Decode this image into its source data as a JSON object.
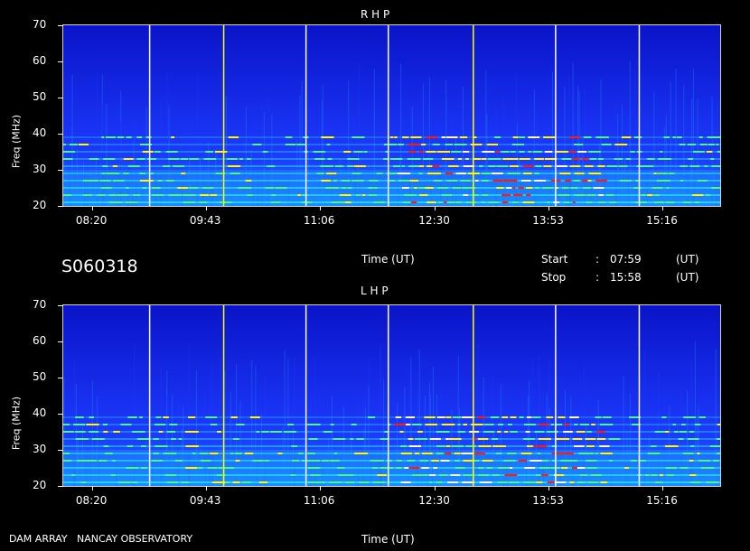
{
  "header": {
    "session_id": "S060318",
    "time_axis_label": "Time (UT)",
    "start_label": "Start",
    "stop_label": "Stop",
    "separator": ":",
    "start_time": "07:59",
    "stop_time": "15:58",
    "unit": "(UT)"
  },
  "footer": {
    "credit": "DAM ARRAY   NANCAY OBSERVATORY",
    "time_axis_label": "Time (UT)"
  },
  "chart_data": [
    {
      "type": "heatmap",
      "title": "R H P",
      "xlabel": "Time (UT)",
      "ylabel": "Freq (MHz)",
      "xlim": [
        "07:59",
        "15:58"
      ],
      "ylim": [
        20,
        70
      ],
      "x_ticks": [
        "08:20",
        "09:43",
        "11:06",
        "12:30",
        "13:53",
        "15:16"
      ],
      "y_ticks": [
        20,
        30,
        40,
        50,
        60,
        70
      ],
      "colormap": [
        "#0a14c8",
        "#1e3cff",
        "#1e8cff",
        "#1ee6ff",
        "#46ff82",
        "#ffff00",
        "#ff1e00",
        "#ffffff"
      ],
      "vertical_markers": [
        {
          "time": "09:02",
          "color": "#ffffff"
        },
        {
          "time": "09:56",
          "color": "#ffff00"
        },
        {
          "time": "10:56",
          "color": "#ffffff"
        },
        {
          "time": "11:56",
          "color": "#ffffff"
        },
        {
          "time": "12:58",
          "color": "#ffff00"
        },
        {
          "time": "13:58",
          "color": "#ffffff"
        },
        {
          "time": "14:59",
          "color": "#ffffff"
        }
      ],
      "emission_bands_mhz": [
        21,
        23,
        25,
        27,
        29,
        31,
        33,
        35,
        37,
        39
      ],
      "peak_activity": {
        "time_range": [
          "12:00",
          "14:30"
        ],
        "freq_range": [
          20,
          40
        ]
      }
    },
    {
      "type": "heatmap",
      "title": "L H P",
      "xlabel": "Time (UT)",
      "ylabel": "Freq (MHz)",
      "xlim": [
        "07:59",
        "15:58"
      ],
      "ylim": [
        20,
        70
      ],
      "x_ticks": [
        "08:20",
        "09:43",
        "11:06",
        "12:30",
        "13:53",
        "15:16"
      ],
      "y_ticks": [
        20,
        30,
        40,
        50,
        60,
        70
      ],
      "colormap": [
        "#0a14c8",
        "#1e3cff",
        "#1e8cff",
        "#1ee6ff",
        "#46ff82",
        "#ffff00",
        "#ff1e00",
        "#ffffff"
      ],
      "vertical_markers": [
        {
          "time": "09:02",
          "color": "#ffffff"
        },
        {
          "time": "09:56",
          "color": "#ffff00"
        },
        {
          "time": "10:56",
          "color": "#ffffff"
        },
        {
          "time": "11:56",
          "color": "#ffffff"
        },
        {
          "time": "12:58",
          "color": "#ffff00"
        },
        {
          "time": "13:58",
          "color": "#ffffff"
        },
        {
          "time": "14:59",
          "color": "#ffffff"
        }
      ],
      "emission_bands_mhz": [
        21,
        23,
        25,
        27,
        29,
        31,
        33,
        35,
        37,
        39
      ],
      "peak_activity": {
        "time_range": [
          "12:00",
          "14:30"
        ],
        "freq_range": [
          20,
          40
        ]
      }
    }
  ]
}
